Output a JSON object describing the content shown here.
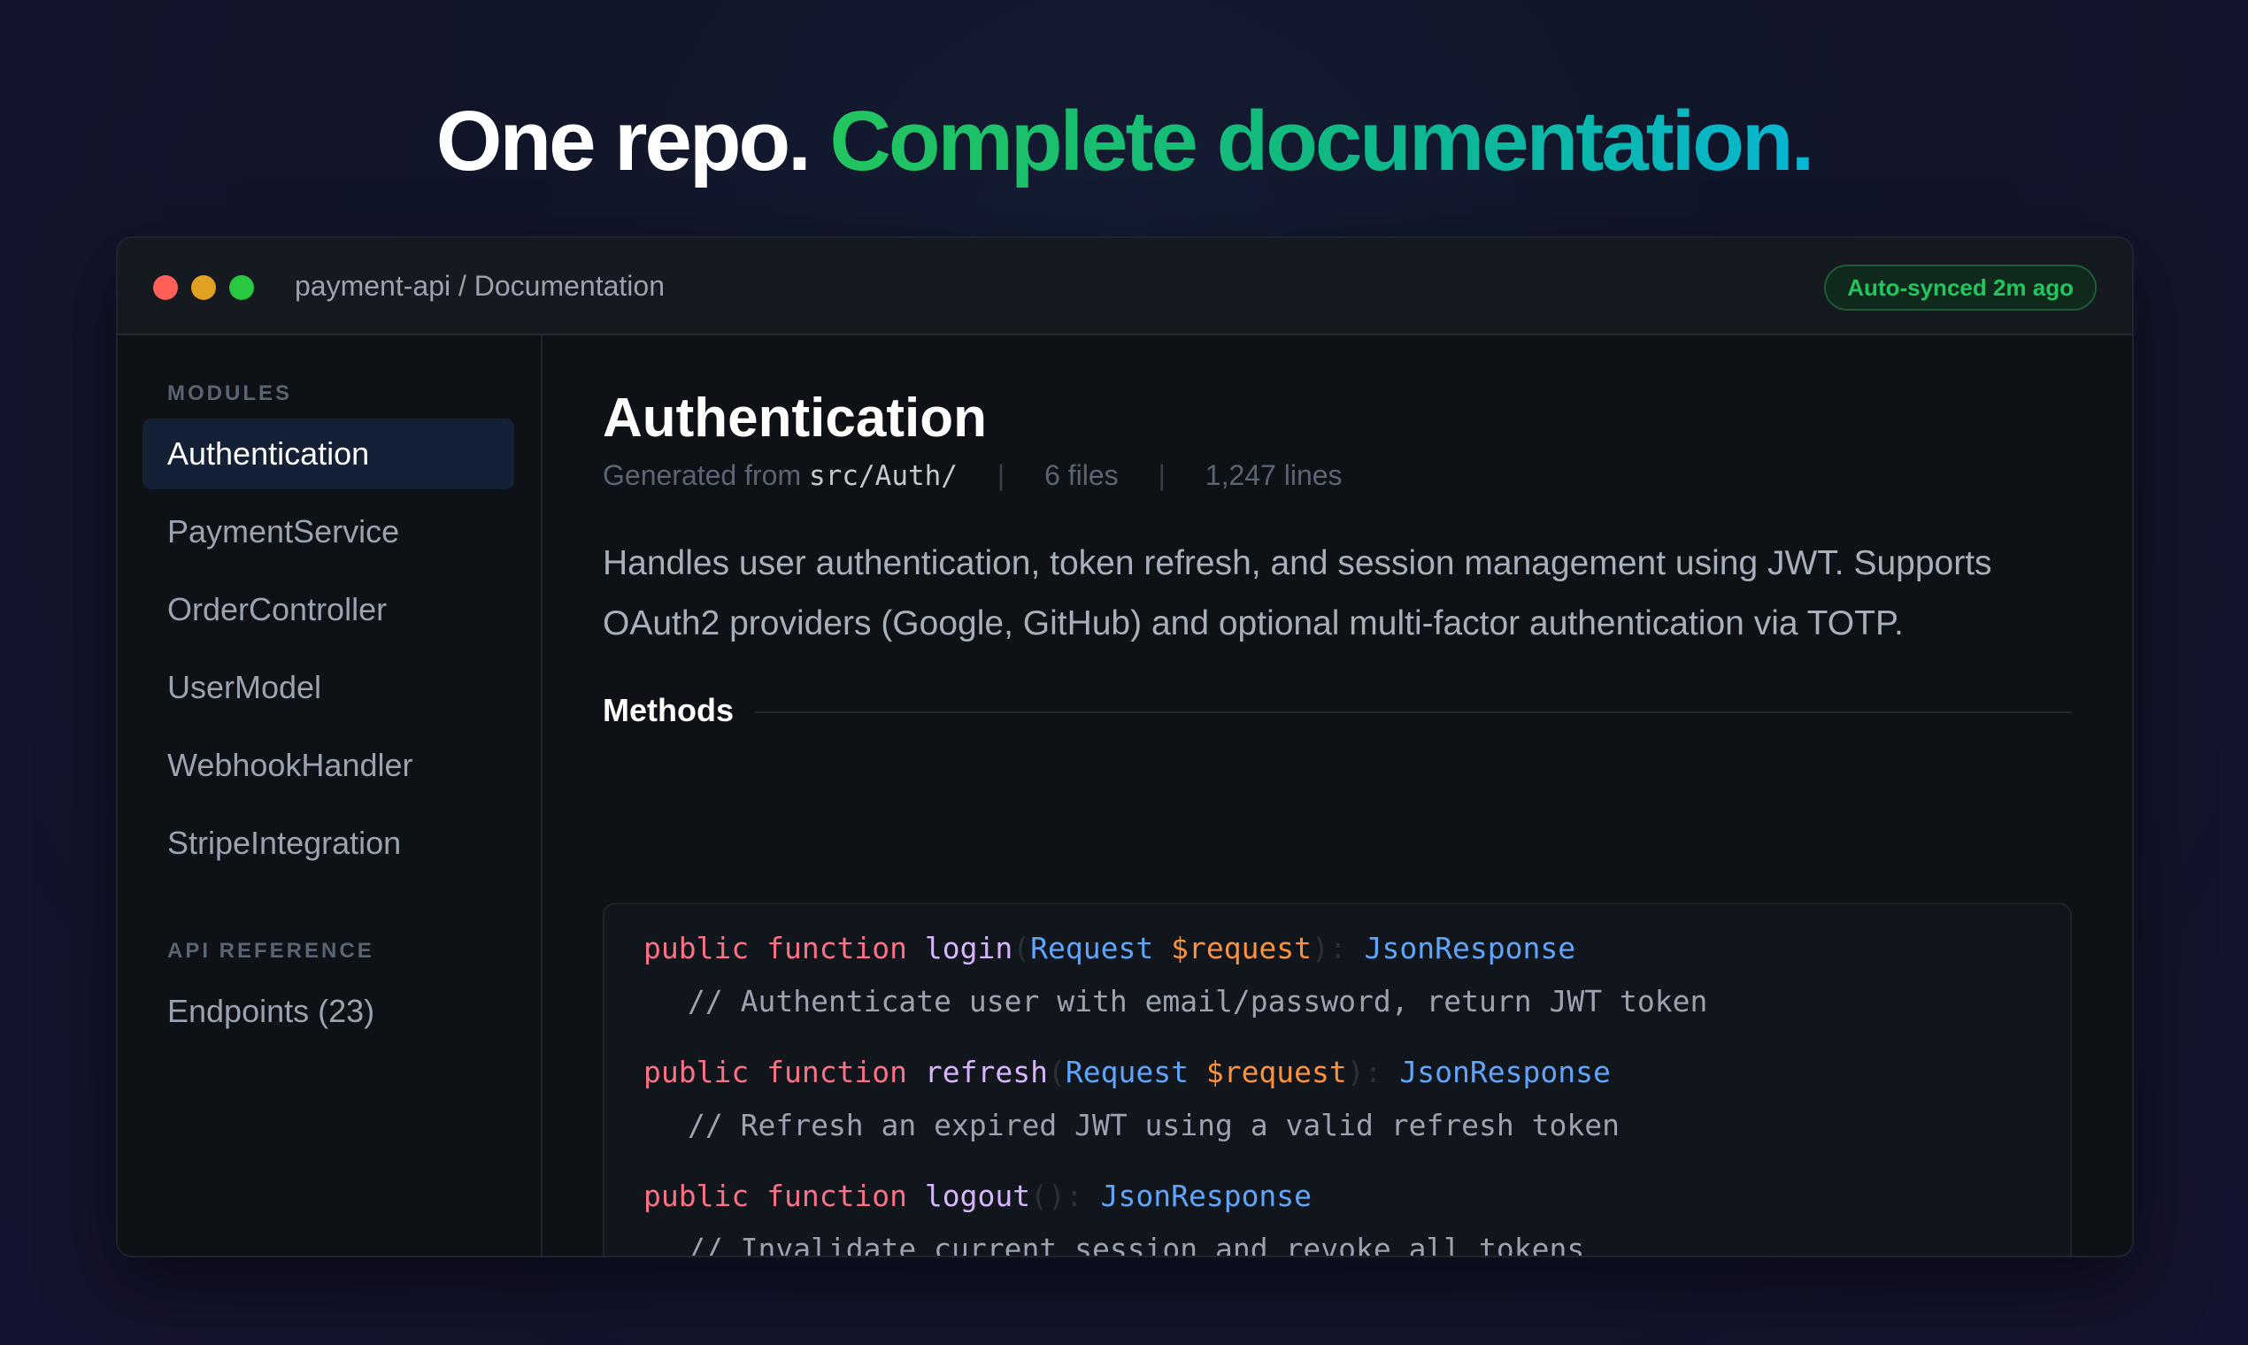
{
  "headline": {
    "plain": "One repo.",
    "accent": "Complete documentation."
  },
  "window": {
    "title": "payment-api / Documentation",
    "sync_badge": "Auto-synced 2m ago"
  },
  "sidebar": {
    "modules_label": "MODULES",
    "items": [
      {
        "label": "Authentication",
        "active": true
      },
      {
        "label": "PaymentService",
        "active": false
      },
      {
        "label": "OrderController",
        "active": false
      },
      {
        "label": "UserModel",
        "active": false
      },
      {
        "label": "WebhookHandler",
        "active": false
      },
      {
        "label": "StripeIntegration",
        "active": false
      }
    ],
    "api_label": "API REFERENCE",
    "api_items": [
      {
        "label": "Endpoints (23)"
      }
    ]
  },
  "main": {
    "title": "Authentication",
    "generated_prefix": "Generated from",
    "source_path": "src/Auth/",
    "files": "6 files",
    "lines": "1,247 lines",
    "separator": "|",
    "description": "Handles user authentication, token refresh, and session management using JWT. Supports OAuth2 providers (Google, GitHub) and optional multi-factor authentication via TOTP.",
    "methods_heading": "Methods",
    "methods": [
      {
        "keyword_public": "public",
        "keyword_function": "function",
        "name": "login",
        "open_paren": "(",
        "param_type": "Request",
        "param_var": "$request",
        "close": "):",
        "return_type": "JsonResponse",
        "comment": "// Authenticate user with email/password, return JWT token"
      },
      {
        "keyword_public": "public",
        "keyword_function": "function",
        "name": "refresh",
        "open_paren": "(",
        "param_type": "Request",
        "param_var": "$request",
        "close": "):",
        "return_type": "JsonResponse",
        "comment": "// Refresh an expired JWT using a valid refresh token"
      },
      {
        "keyword_public": "public",
        "keyword_function": "function",
        "name": "logout",
        "open_paren": "",
        "param_type": "",
        "param_var": "",
        "close": "():",
        "return_type": "JsonResponse",
        "comment": "// Invalidate current session and revoke all tokens"
      }
    ]
  },
  "colors": {
    "accent_green": "#22c55e",
    "accent_cyan": "#06b6d4",
    "keyword": "#f87185",
    "function_name": "#d8b4fe",
    "type": "#60a5fa",
    "variable": "#fb923c"
  }
}
